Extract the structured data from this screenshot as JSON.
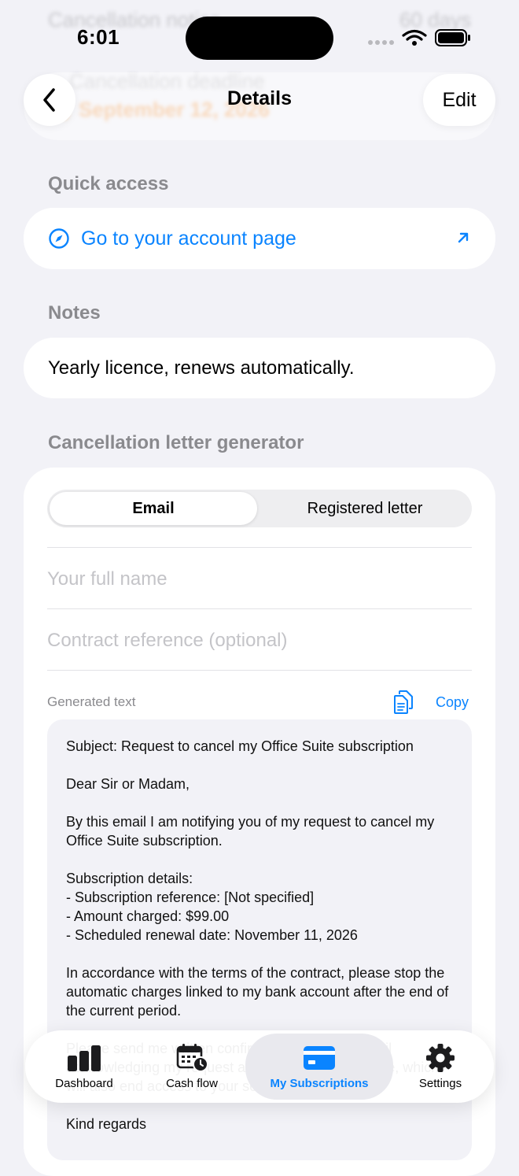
{
  "colors": {
    "accent": "#0a84ff",
    "background": "#f2f2f7",
    "card": "#ffffff",
    "secondary_text": "#8a8a8e"
  },
  "status_bar": {
    "time": "6:01"
  },
  "background_content": {
    "cancellation_notice_label": "Cancellation notice",
    "cancellation_notice_value": "60 days",
    "cancellation_deadline_label": "Cancellation deadline",
    "cancellation_deadline_value": "September 12, 2026"
  },
  "nav": {
    "title": "Details",
    "back_icon": "chevron-left-icon",
    "edit_label": "Edit"
  },
  "quick_access": {
    "header": "Quick access",
    "link_label": "Go to your account page",
    "link_icon": "compass-icon",
    "external_icon": "arrow-up-right-icon"
  },
  "notes": {
    "header": "Notes",
    "text": "Yearly licence, renews automatically."
  },
  "generator": {
    "header": "Cancellation letter generator",
    "segments": [
      {
        "label": "Email",
        "selected": true
      },
      {
        "label": "Registered letter",
        "selected": false
      }
    ],
    "name_placeholder": "Your full name",
    "reference_placeholder": "Contract reference (optional)",
    "generated_label": "Generated text",
    "copy_label": "Copy",
    "generated_text": "Subject: Request to cancel my Office Suite subscription\n\nDear Sir or Madam,\n\nBy this email I am notifying you of my request to cancel my Office Suite subscription.\n\nSubscription details:\n- Subscription reference: [Not specified]\n- Amount charged: $99.00\n- Scheduled renewal date: November 11, 2026\n\nIn accordance with the terms of the contract, please stop the automatic charges linked to my bank account after the end of the current period.\n\nPlease send me written confirmation by return email acknowledging my request and the cancellation date, which will also end access to your services.\n\nKind regards"
  },
  "tab_bar": {
    "tabs": [
      {
        "label": "Dashboard",
        "icon": "bar-chart-icon",
        "selected": false
      },
      {
        "label": "Cash flow",
        "icon": "calendar-clock-icon",
        "selected": false
      },
      {
        "label": "My Subscriptions",
        "icon": "credit-card-icon",
        "selected": true
      },
      {
        "label": "Settings",
        "icon": "gear-icon",
        "selected": false
      }
    ]
  }
}
